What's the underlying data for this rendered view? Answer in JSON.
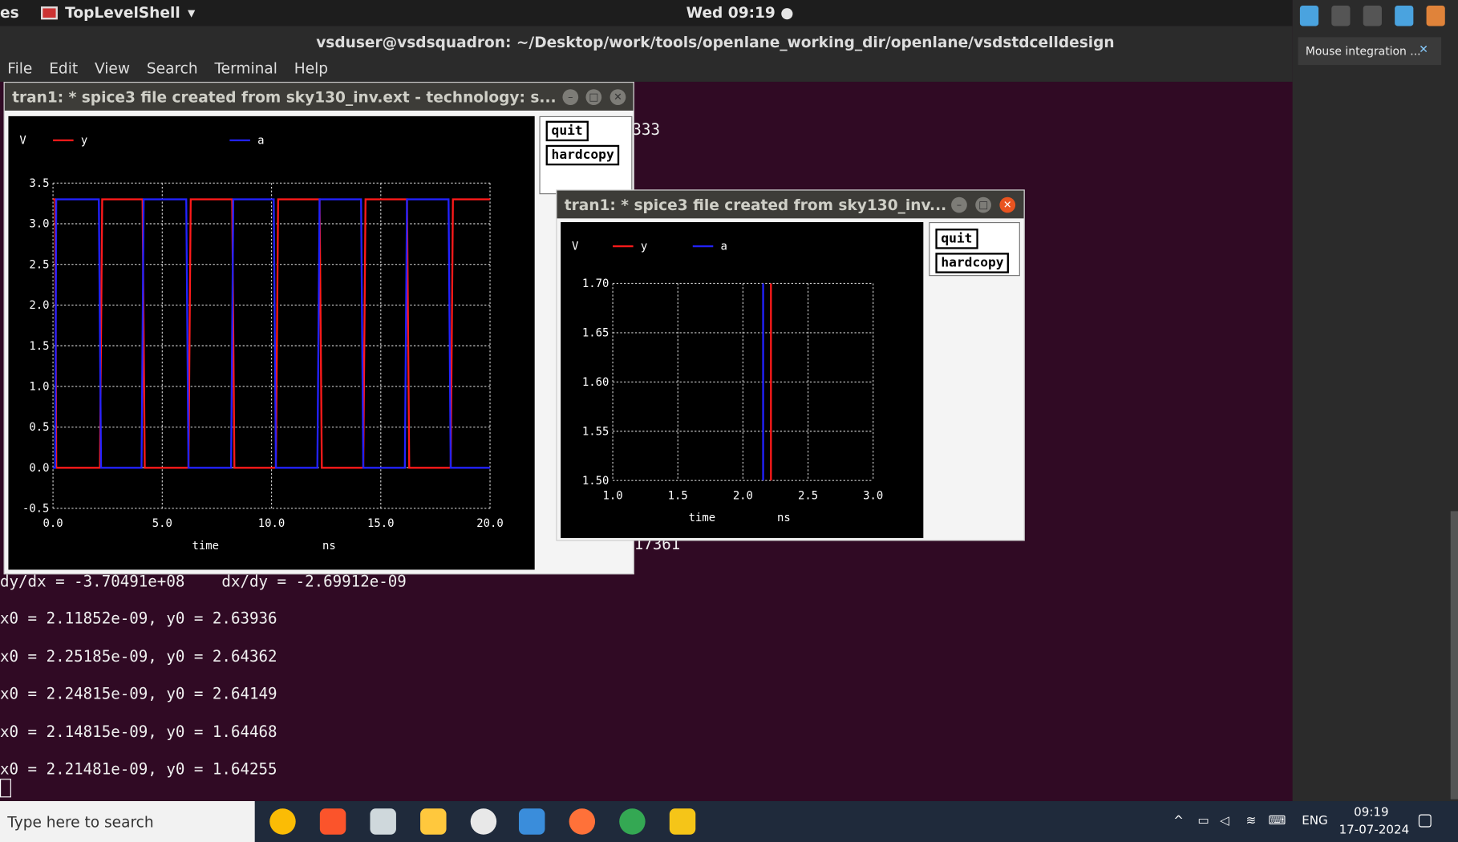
{
  "topbar": {
    "activities": "es",
    "app_name": "TopLevelShell",
    "clock": "Wed 09:19"
  },
  "terminal": {
    "title": "vsduser@vsdsquadron: ~/Desktop/work/tools/openlane_working_dir/openlane/vsdstdcelldesign",
    "menu": [
      "File",
      "Edit",
      "View",
      "Search",
      "Terminal",
      "Help"
    ],
    "lines": [
      "333",
      "17361",
      "dy/dx = -3.70491e+08    dx/dy = -2.69912e-09",
      "x0 = 2.11852e-09, y0 = 2.63936",
      "x0 = 2.25185e-09, y0 = 2.64362",
      "x0 = 2.24815e-09, y0 = 2.64149",
      "x0 = 2.14815e-09, y0 = 1.64468",
      "x0 = 2.21481e-09, y0 = 1.64255"
    ]
  },
  "side": {
    "mouse_integration": "Mouse integration ..."
  },
  "win1": {
    "title": "tran1: * spice3 file created from sky130_inv.ext - technology: s...",
    "quit": "quit",
    "hardcopy": "hardcopy"
  },
  "win2": {
    "title": "tran1: * spice3 file created from sky130_inv...",
    "quit": "quit",
    "hardcopy": "hardcopy"
  },
  "taskbar": {
    "search": "Type here to search",
    "lang": "ENG",
    "time": "09:19",
    "date": "17-07-2024"
  },
  "chart_data": [
    {
      "type": "line",
      "ylabel": "V",
      "xlabel": "time",
      "xunit": "ns",
      "xlim": [
        0,
        20
      ],
      "ylim": [
        -0.5,
        3.5
      ],
      "xticks": [
        "0.0",
        "5.0",
        "10.0",
        "15.0",
        "20.0"
      ],
      "yticks": [
        "-0.5",
        "0.0",
        "0.5",
        "1.0",
        "1.5",
        "2.0",
        "2.5",
        "3.0",
        "3.5"
      ],
      "series": [
        {
          "name": "y",
          "color": "#ff1a1a",
          "x": [
            0,
            0.1,
            0.15,
            2.15,
            2.25,
            2.35,
            4.1,
            4.2,
            4.35,
            6.2,
            6.3,
            6.4,
            8.2,
            8.3,
            8.4,
            10.2,
            10.3,
            10.4,
            12.2,
            12.3,
            12.4,
            14.2,
            14.3,
            14.45,
            16.2,
            16.3,
            16.4,
            18.2,
            18.3,
            18.45,
            20
          ],
          "y": [
            3.3,
            3.3,
            0,
            0,
            3.3,
            3.3,
            3.3,
            0,
            0,
            0,
            3.3,
            3.3,
            3.3,
            0,
            0,
            0,
            3.3,
            3.3,
            3.3,
            0,
            0,
            0,
            3.3,
            3.3,
            3.3,
            0,
            0,
            0,
            3.3,
            3.3,
            3.3
          ]
        },
        {
          "name": "a",
          "color": "#2222ff",
          "x": [
            0,
            0.1,
            0.15,
            2.1,
            2.2,
            4.05,
            4.15,
            6.1,
            6.2,
            8.15,
            8.25,
            10.1,
            10.2,
            12.1,
            12.2,
            14.1,
            14.2,
            16.1,
            16.2,
            18.1,
            18.2,
            20
          ],
          "y": [
            0,
            0,
            3.3,
            3.3,
            0,
            0,
            3.3,
            3.3,
            0,
            0,
            3.3,
            3.3,
            0,
            0,
            3.3,
            3.3,
            0,
            0,
            3.3,
            3.3,
            0,
            0
          ]
        }
      ],
      "grid": true,
      "legend": "top"
    },
    {
      "type": "line",
      "ylabel": "V",
      "xlabel": "time",
      "xunit": "ns",
      "xlim": [
        1.0,
        3.0
      ],
      "ylim": [
        1.5,
        1.7
      ],
      "xticks": [
        "1.0",
        "1.5",
        "2.0",
        "2.5",
        "3.0"
      ],
      "yticks": [
        "1.50",
        "1.55",
        "1.60",
        "1.65",
        "1.70"
      ],
      "series": [
        {
          "name": "y",
          "color": "#ff1a1a",
          "x": [
            2.215,
            2.215
          ],
          "y": [
            1.5,
            1.7
          ]
        },
        {
          "name": "a",
          "color": "#2222ff",
          "x": [
            2.155,
            2.155
          ],
          "y": [
            1.5,
            1.7
          ]
        }
      ],
      "grid": true,
      "legend": "top"
    }
  ]
}
